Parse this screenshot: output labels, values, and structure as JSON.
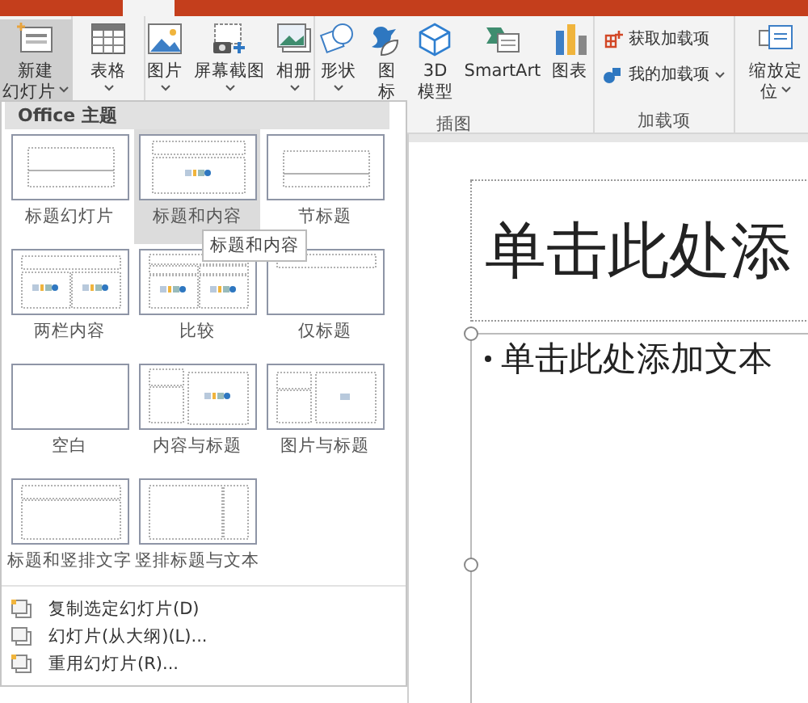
{
  "ribbon": {
    "groups": [
      {
        "buttons": [
          {
            "lines": [
              "新建",
              "幻灯片"
            ],
            "has_menu": true,
            "pressed": true
          }
        ]
      },
      {
        "buttons": [
          {
            "lines": [
              "表格"
            ],
            "has_menu": true,
            "pressed": false
          }
        ]
      },
      {
        "buttons": [
          {
            "lines": [
              "图片"
            ],
            "has_menu": true,
            "pressed": false
          },
          {
            "lines": [
              "屏幕截图"
            ],
            "has_menu": true,
            "pressed": false
          },
          {
            "lines": [
              "相册"
            ],
            "has_menu": true,
            "pressed": false
          }
        ]
      },
      {
        "label": "插图",
        "buttons": [
          {
            "lines": [
              "形状"
            ],
            "has_menu": true,
            "pressed": false
          },
          {
            "lines": [
              "图",
              "标"
            ],
            "has_menu": false,
            "pressed": false
          },
          {
            "lines": [
              "3D",
              "模型"
            ],
            "has_menu": false,
            "pressed": false
          },
          {
            "lines": [
              "SmartArt"
            ],
            "has_menu": false,
            "pressed": false
          },
          {
            "lines": [
              "图表"
            ],
            "has_menu": false,
            "pressed": false
          }
        ]
      },
      {
        "label": "加载项",
        "small_buttons": [
          {
            "label": "获取加载项",
            "has_menu": false
          },
          {
            "label": "我的加载项",
            "has_menu": true
          }
        ]
      },
      {
        "buttons": [
          {
            "lines": [
              "缩放定",
              "位"
            ],
            "has_menu": true,
            "pressed": false
          }
        ]
      }
    ]
  },
  "layout_menu": {
    "header": "Office 主题",
    "layouts": [
      {
        "label": "标题幻灯片",
        "kind": "title",
        "hovered": false
      },
      {
        "label": "标题和内容",
        "kind": "title_content",
        "hovered": true
      },
      {
        "label": "节标题",
        "kind": "section",
        "hovered": false
      },
      {
        "label": "两栏内容",
        "kind": "two_content",
        "hovered": false
      },
      {
        "label": "比较",
        "kind": "comparison",
        "hovered": false
      },
      {
        "label": "仅标题",
        "kind": "title_only",
        "hovered": false
      },
      {
        "label": "空白",
        "kind": "blank",
        "hovered": false
      },
      {
        "label": "内容与标题",
        "kind": "content_caption",
        "hovered": false
      },
      {
        "label": "图片与标题",
        "kind": "picture_caption",
        "hovered": false
      },
      {
        "label": "标题和竖排文字",
        "kind": "title_vertical",
        "hovered": false
      },
      {
        "label": "竖排标题与文本",
        "kind": "vertical_title",
        "hovered": false
      }
    ],
    "tooltip": "标题和内容",
    "commands": [
      {
        "label": "复制选定幻灯片(D)"
      },
      {
        "label": "幻灯片(从大纲)(L)..."
      },
      {
        "label": "重用幻灯片(R)..."
      }
    ]
  },
  "slide": {
    "title_placeholder": "单击此处添",
    "body_placeholder": "单击此处添加文本"
  }
}
